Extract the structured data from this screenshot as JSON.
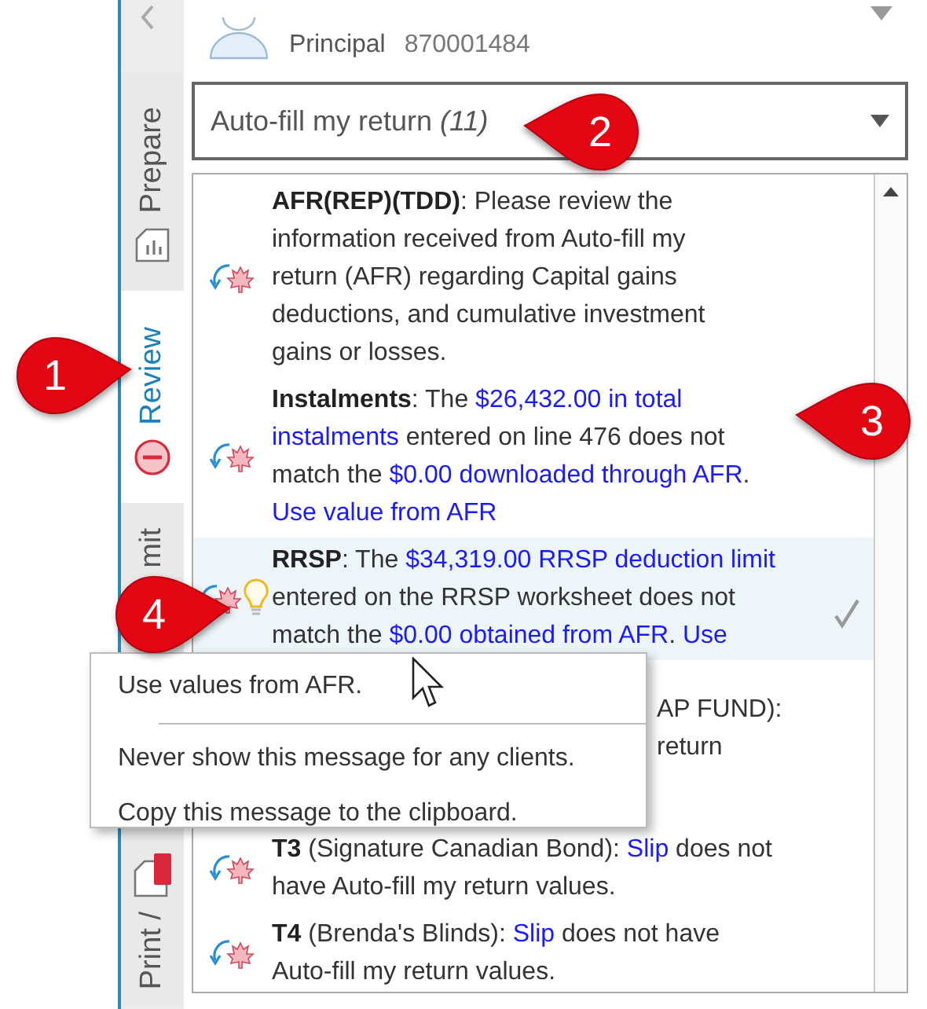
{
  "header": {
    "role": "Principal",
    "number": "870001484"
  },
  "tabs": [
    {
      "label": "Prepare",
      "kind": "chart",
      "selected": false
    },
    {
      "label": "Review",
      "kind": "alert",
      "selected": true
    },
    {
      "label": "mit",
      "kind": "plain",
      "selected": false
    },
    {
      "label": "Print /",
      "kind": "pdf",
      "selected": false
    }
  ],
  "filter": {
    "value": "Auto-fill my return *(11)*"
  },
  "messages": [
    {
      "kind": "afr",
      "selected": false,
      "checked": false,
      "hint": false,
      "lines": [
        [
          {
            "kind": "bold",
            "text": "AFR(REP)(TDD)"
          },
          {
            "kind": "text",
            "text": ": Please review the"
          }
        ],
        [
          {
            "kind": "text",
            "text": "information received from Auto-fill my"
          }
        ],
        [
          {
            "kind": "text",
            "text": "return (AFR) regarding Capital gains"
          }
        ],
        [
          {
            "kind": "text",
            "text": "deductions, and cumulative investment"
          }
        ],
        [
          {
            "kind": "text",
            "text": "gains or losses."
          }
        ]
      ]
    },
    {
      "kind": "afr",
      "selected": false,
      "checked": false,
      "hint": false,
      "lines": [
        [
          {
            "kind": "bold",
            "text": "Instalments"
          },
          {
            "kind": "text",
            "text": ": The "
          },
          {
            "kind": "link",
            "text": "$26,432.00 in total"
          }
        ],
        [
          {
            "kind": "link",
            "text": "instalments"
          },
          {
            "kind": "text",
            "text": " entered on line 476 does not"
          }
        ],
        [
          {
            "kind": "text",
            "text": "match the "
          },
          {
            "kind": "link",
            "text": "$0.00 downloaded through AFR"
          },
          {
            "kind": "text",
            "text": "."
          }
        ],
        [
          {
            "kind": "link",
            "text": "Use value from AFR"
          }
        ]
      ]
    },
    {
      "kind": "afr",
      "selected": true,
      "checked": true,
      "hint": true,
      "lines": [
        [
          {
            "kind": "bold",
            "text": "RRSP"
          },
          {
            "kind": "text",
            "text": ": The "
          },
          {
            "kind": "link",
            "text": "$34,319.00 RRSP deduction limit"
          }
        ],
        [
          {
            "kind": "text",
            "text": "entered on the RRSP worksheet does not"
          }
        ],
        [
          {
            "kind": "text",
            "text": "match the "
          },
          {
            "kind": "link",
            "text": "$0.00 obtained from AFR"
          },
          {
            "kind": "text",
            "text": ". "
          },
          {
            "kind": "link",
            "text": "Use"
          }
        ]
      ]
    },
    {
      "kind": "obscured",
      "lines": [
        [
          {
            "kind": "text",
            "text": "AP FUND):"
          }
        ],
        [
          {
            "kind": "text",
            "text": "return"
          }
        ]
      ]
    },
    {
      "kind": "afr",
      "selected": false,
      "checked": false,
      "hint": false,
      "lines": [
        [
          {
            "kind": "bold",
            "text": "T3"
          },
          {
            "kind": "text",
            "text": " (Signature Canadian Bond): "
          },
          {
            "kind": "link",
            "text": "Slip"
          },
          {
            "kind": "text",
            "text": " does not"
          }
        ],
        [
          {
            "kind": "text",
            "text": "have Auto-fill my return values."
          }
        ]
      ]
    },
    {
      "kind": "afr",
      "selected": false,
      "checked": false,
      "hint": false,
      "lines": [
        [
          {
            "kind": "bold",
            "text": "T4"
          },
          {
            "kind": "text",
            "text": " (Brenda's Blinds): "
          },
          {
            "kind": "link",
            "text": "Slip"
          },
          {
            "kind": "text",
            "text": " does not have"
          }
        ],
        [
          {
            "kind": "text",
            "text": "Auto-fill my return values."
          }
        ]
      ]
    }
  ],
  "context_menu": {
    "items": [
      {
        "label": "Use values from AFR.",
        "separator_after": true
      },
      {
        "label": "Never show this message for any clients.",
        "separator_after": false
      },
      {
        "label": "Copy this message to the clipboard.",
        "separator_after": false
      }
    ]
  },
  "callouts": [
    {
      "number": "1"
    },
    {
      "number": "2"
    },
    {
      "number": "3"
    },
    {
      "number": "4"
    }
  ]
}
